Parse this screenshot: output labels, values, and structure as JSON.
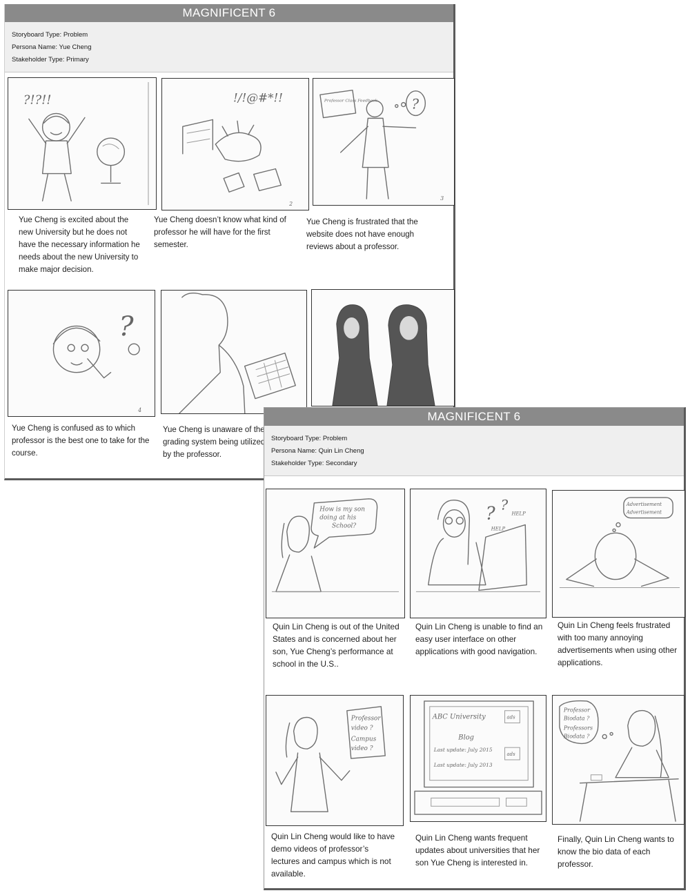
{
  "sheets": [
    {
      "title": "MAGNIFICENT 6",
      "storyboard_type": "Storyboard Type: Problem",
      "persona_name": "Persona Name:  Yue Cheng",
      "stakeholder_type": "Stakeholder Type:  Primary",
      "captions": [
        "Yue Cheng is excited about the new University but he does not have the necessary information he needs about the new University to  make major decision.",
        "Yue Cheng doesn’t know what kind of professor he will have for the first semester.",
        "Yue Cheng is frustrated that the website does not have enough reviews about a professor.",
        "Yue Cheng is confused as to which professor is the best one to take for the course.",
        "Yue Cheng is unaware of the grading system being utilized by the professor."
      ],
      "sketch_text": {
        "p1_exclaim": "?!?!!",
        "p2_exclaim": "!/!@#*!!",
        "p3_board": "Professor Class Feedback",
        "p2_num": "2",
        "p3_num": "3",
        "p4_num": "4"
      }
    },
    {
      "title": "MAGNIFICENT 6",
      "storyboard_type": "Storyboard Type: Problem",
      "persona_name": "Persona Name:  Quin Lin Cheng",
      "stakeholder_type": "Stakeholder Type:  Secondary",
      "captions": [
        "Quin Lin Cheng is out of the United States and is concerned about her son, Yue Cheng’s performance at school in the U.S..",
        "Quin Lin Cheng is unable to find an easy user interface on other applications with good navigation.",
        "Quin Lin Cheng feels frustrated with too many annoying advertisements when using other applications.",
        "Quin Lin Cheng would like to have demo videos of professor’s  lectures and campus which is not available.",
        "Quin Lin Cheng wants frequent updates about universities that her son Yue Cheng is interested in.",
        "Finally, Quin Lin Cheng wants to know the bio data of each professor."
      ],
      "sketch_text": {
        "p1_bubble_1": "How is my son",
        "p1_bubble_2": "doing at his",
        "p1_bubble_3": "School?",
        "p2_help_1": "HELP",
        "p2_help_2": "HELP",
        "p3_ad_1": "Advertisement",
        "p3_ad_2": "Advertisement",
        "p4_bubble_1": "Professor",
        "p4_bubble_2": "video ?",
        "p4_bubble_3": "Campus",
        "p4_bubble_4": "video ?",
        "p5_screen_1": "ABC University",
        "p5_screen_2": "Blog",
        "p5_screen_3": "Last update: July 2015",
        "p5_screen_4": "Last update: July 2013",
        "p5_ads_1": "ads",
        "p5_ads_2": "ads",
        "p6_bubble_1": "Professor",
        "p6_bubble_2": "Biodata ?",
        "p6_bubble_3": "Professors",
        "p6_bubble_4": "Biodata ?"
      }
    }
  ]
}
